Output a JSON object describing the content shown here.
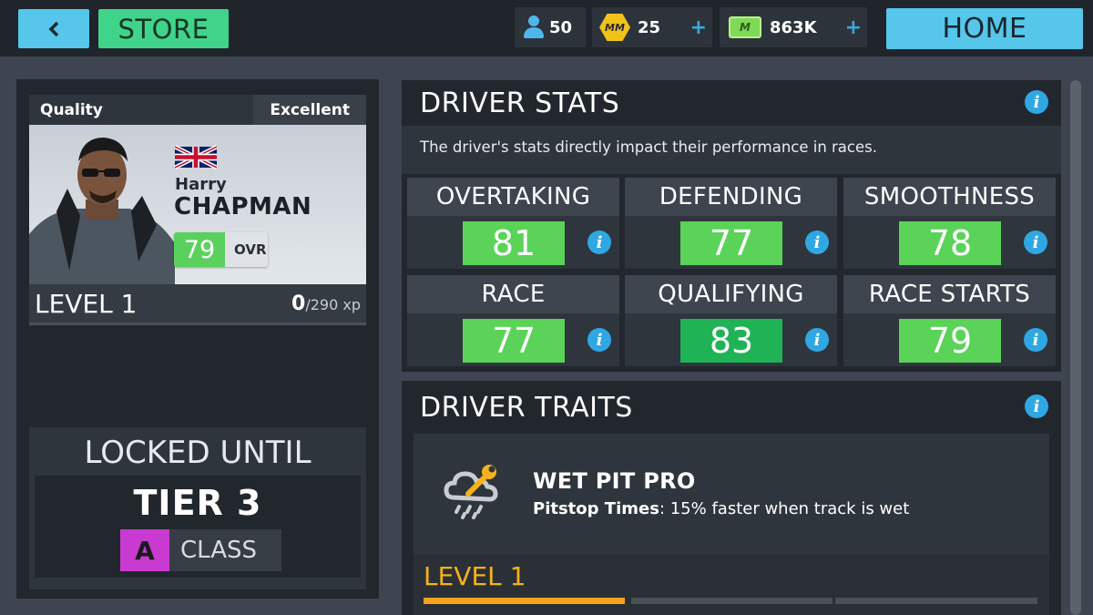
{
  "topbar": {
    "back_icon": "chevron-left",
    "store_label": "STORE",
    "drivers_count": "50",
    "tokens_count": "25",
    "tokens_icon_text": "MM",
    "cash_amount": "863K",
    "cash_icon_text": "M",
    "plus_symbol": "+",
    "home_label": "HOME"
  },
  "driver": {
    "quality_label": "Quality",
    "quality_value": "Excellent",
    "first_name": "Harry",
    "last_name": "CHAPMAN",
    "ovr_value": "79",
    "ovr_label": "OVR",
    "level_label": "LEVEL 1",
    "xp_current": "0",
    "xp_total": "/290 xp"
  },
  "lock": {
    "title": "LOCKED UNTIL",
    "tier": "TIER 3",
    "class_letter": "A",
    "class_word": "CLASS"
  },
  "stats": {
    "title": "DRIVER STATS",
    "description": "The driver's stats directly impact their performance in races.",
    "items": [
      {
        "name": "OVERTAKING",
        "value": "81"
      },
      {
        "name": "DEFENDING",
        "value": "77"
      },
      {
        "name": "SMOOTHNESS",
        "value": "78"
      },
      {
        "name": "RACE",
        "value": "77"
      },
      {
        "name": "QUALIFYING",
        "value": "83"
      },
      {
        "name": "RACE STARTS",
        "value": "79"
      }
    ]
  },
  "traits": {
    "title": "DRIVER TRAITS",
    "trait_name": "WET PIT PRO",
    "trait_desc_key": "Pitstop Times",
    "trait_desc_value": ": 15% faster when track is wet",
    "trait_level": "LEVEL 1",
    "level_progress_segments_filled": 1,
    "level_progress_segments_total": 3
  },
  "info_symbol": "i",
  "colors": {
    "accent_blue": "#56c6ea",
    "store_green": "#3fd48a",
    "stat_green": "#5ad358",
    "stat_green_dark": "#1fb356",
    "class_purple": "#c93ad1",
    "trait_gold": "#f6b21b"
  }
}
